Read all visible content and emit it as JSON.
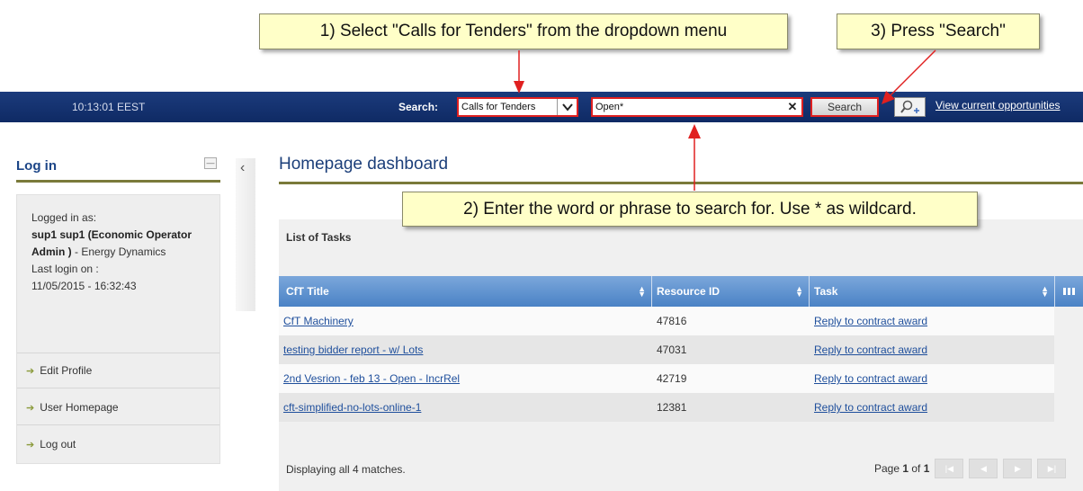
{
  "callouts": {
    "step1": "1) Select \"Calls for Tenders\" from the dropdown menu",
    "step2": "2) Enter the word or phrase to search for. Use * as wildcard.",
    "step3": "3) Press \"Search\""
  },
  "topbar": {
    "clock": "10:13:01 EEST",
    "search_label": "Search:",
    "search_type": "Calls for Tenders",
    "search_query": "Open*",
    "search_button": "Search",
    "view_opportunities": "View current opportunities",
    "clear_icon": "close-icon",
    "advanced_icon": "advanced-search-icon"
  },
  "login": {
    "title": "Log in",
    "logged_in_as_label": "Logged in as:",
    "user_bold": "sup1 sup1 (Economic Operator Admin )",
    "user_org": " - Energy Dynamics",
    "last_login_label": "Last login on :",
    "last_login_value": "11/05/2015 - 16:32:43",
    "links": [
      "Edit Profile",
      "User Homepage",
      "Log out"
    ]
  },
  "dashboard": {
    "title": "Homepage dashboard",
    "tasks_title": "List of Tasks",
    "columns": [
      "CfT Title",
      "Resource ID",
      "Task"
    ],
    "rows": [
      {
        "title": "CfT Machinery",
        "resource_id": "47816",
        "task": "Reply to contract award"
      },
      {
        "title": "testing bidder report - w/ Lots",
        "resource_id": "47031",
        "task": "Reply to contract award"
      },
      {
        "title": "2nd Vesrion - feb 13 - Open - IncrRel",
        "resource_id": "42719",
        "task": "Reply to contract award"
      },
      {
        "title": "cft-simplified-no-lots-online-1",
        "resource_id": "12381",
        "task": "Reply to contract award"
      }
    ],
    "footer": "Displaying all 4 matches.",
    "pager": {
      "prefix": "Page ",
      "current": "1",
      "middle": " of ",
      "total": "1"
    }
  },
  "colors": {
    "topbar": "#0f2a64",
    "callout_bg": "#ffffc8",
    "highlight": "#e02020",
    "grid_header": "#4a82c5",
    "link": "#1f4f9c",
    "accent_rule": "#7a7a3a"
  }
}
